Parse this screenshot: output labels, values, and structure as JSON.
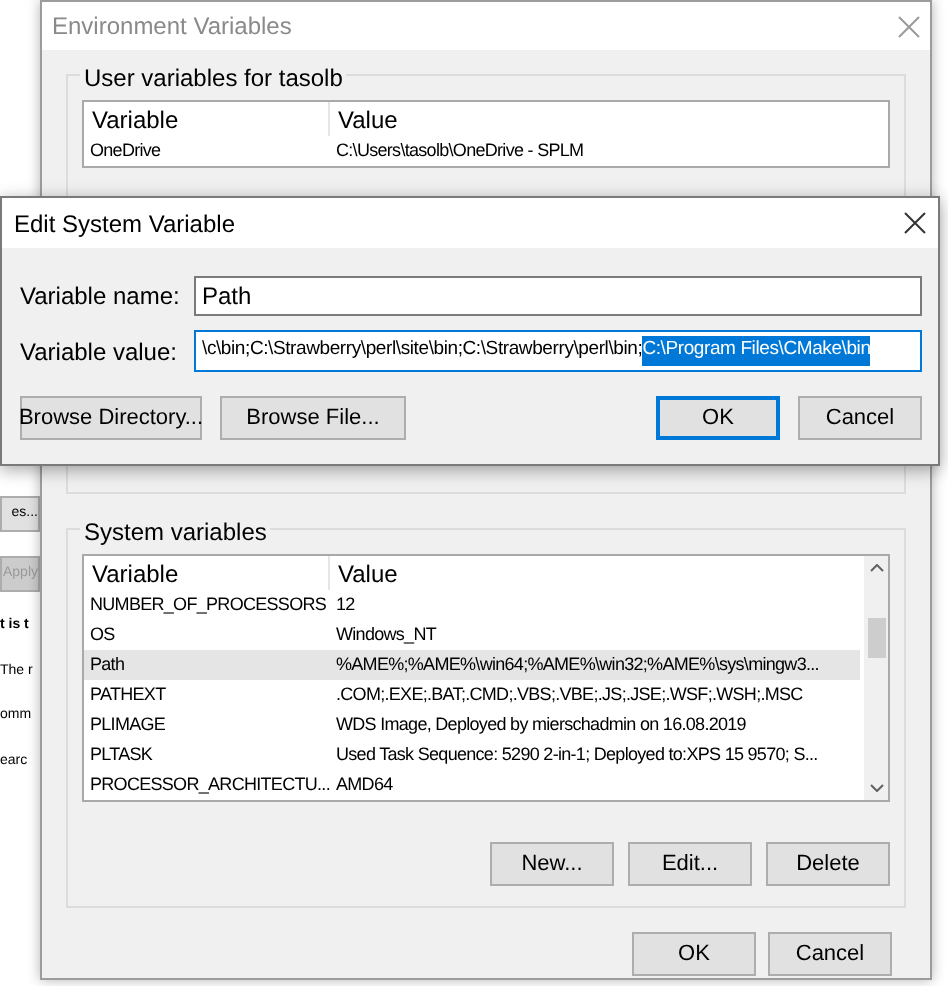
{
  "background_window": {
    "fragments": [
      {
        "kind": "button",
        "text": "es...",
        "disabled": false
      },
      {
        "kind": "button",
        "text": "Apply",
        "disabled": true
      },
      {
        "kind": "bold",
        "text": "t is t"
      },
      {
        "kind": "text",
        "text": "The r"
      },
      {
        "kind": "text",
        "text": "omm"
      },
      {
        "kind": "text",
        "text": "earc"
      }
    ]
  },
  "env_window": {
    "title": "Environment Variables",
    "user_group": {
      "label": "User variables for tasolb",
      "columns": [
        "Variable",
        "Value"
      ],
      "rows": [
        {
          "cells": [
            "OneDrive",
            "C:\\Users\\tasolb\\OneDrive - SPLM"
          ],
          "selected": false
        }
      ]
    },
    "system_group": {
      "label": "System variables",
      "columns": [
        "Variable",
        "Value"
      ],
      "rows": [
        {
          "cells": [
            "NUMBER_OF_PROCESSORS",
            "12"
          ],
          "selected": false
        },
        {
          "cells": [
            "OS",
            "Windows_NT"
          ],
          "selected": false
        },
        {
          "cells": [
            "Path",
            "%AME%;%AME%\\win64;%AME%\\win32;%AME%\\sys\\mingw3..."
          ],
          "selected": true
        },
        {
          "cells": [
            "PATHEXT",
            ".COM;.EXE;.BAT;.CMD;.VBS;.VBE;.JS;.JSE;.WSF;.WSH;.MSC"
          ],
          "selected": false
        },
        {
          "cells": [
            "PLIMAGE",
            "WDS Image, Deployed by mierschadmin on 16.08.2019"
          ],
          "selected": false
        },
        {
          "cells": [
            "PLTASK",
            "Used Task Sequence: 5290 2-in-1; Deployed to:XPS 15 9570; S..."
          ],
          "selected": false
        },
        {
          "cells": [
            "PROCESSOR_ARCHITECTU...",
            "AMD64"
          ],
          "selected": false
        }
      ],
      "buttons": [
        "New...",
        "Edit...",
        "Delete"
      ]
    },
    "buttons": [
      "OK",
      "Cancel"
    ]
  },
  "edit_dialog": {
    "title": "Edit System Variable",
    "name_label": "Variable name:",
    "name_value": "Path",
    "value_label": "Variable value:",
    "value_before": "\\c\\bin;C:\\Strawberry\\perl\\site\\bin;C:\\Strawberry\\perl\\bin;",
    "value_selected": "C:\\Program Files\\CMake\\bin",
    "buttons": [
      {
        "label": "Browse Directory...",
        "kind": "left",
        "default": false
      },
      {
        "label": "Browse File...",
        "kind": "left",
        "default": false
      },
      {
        "label": "OK",
        "kind": "right",
        "default": true
      },
      {
        "label": "Cancel",
        "kind": "right",
        "default": false
      }
    ]
  }
}
